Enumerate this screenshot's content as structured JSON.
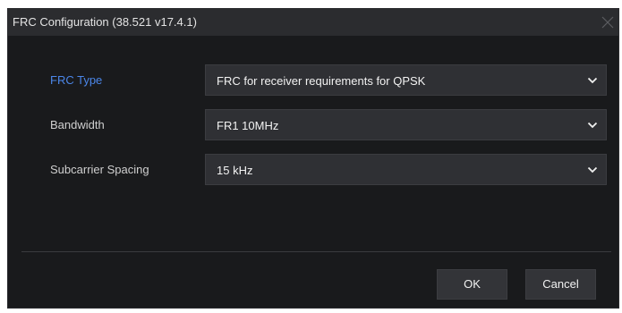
{
  "dialog": {
    "title": "FRC Configuration (38.521 v17.4.1)",
    "close_icon": "close-icon"
  },
  "form": {
    "frc_type": {
      "label": "FRC Type",
      "value": "FRC for receiver requirements for QPSK",
      "icon": "chevron-down-icon"
    },
    "bandwidth": {
      "label": "Bandwidth",
      "value": "FR1 10MHz",
      "icon": "chevron-down-icon"
    },
    "subcarrier_spacing": {
      "label": "Subcarrier Spacing",
      "value": "15 kHz",
      "icon": "chevron-down-icon"
    }
  },
  "buttons": {
    "ok_label": "OK",
    "cancel_label": "Cancel"
  },
  "colors": {
    "background": "#191a1c",
    "titlebar": "#2b2c2f",
    "field": "#2f3034",
    "accent_label": "#4b86e8",
    "text": "#f2f2f2"
  }
}
